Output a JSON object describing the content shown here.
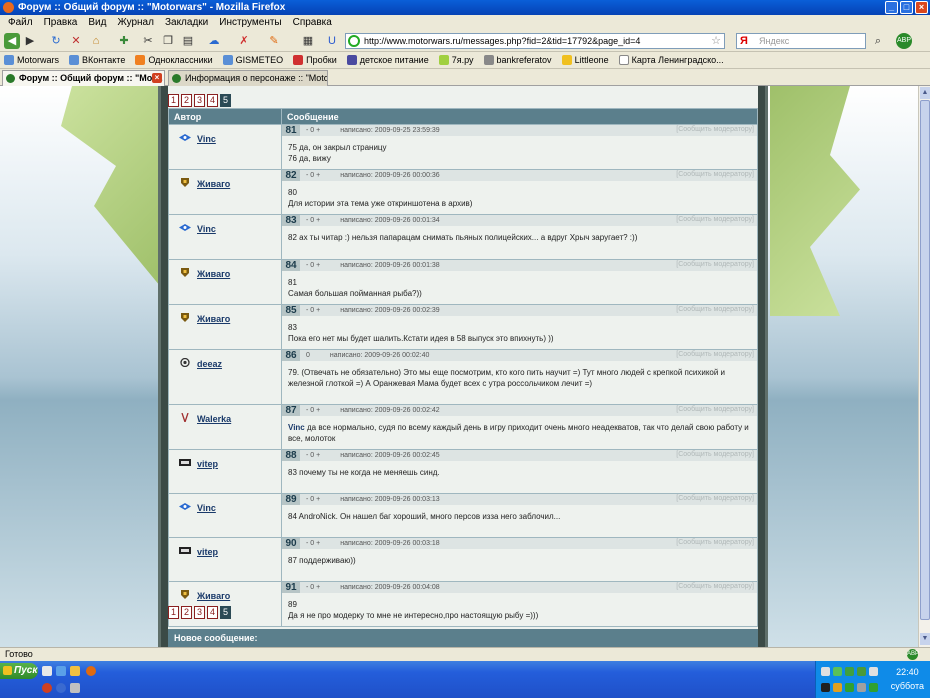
{
  "window": {
    "title": "Форум :: Общий форум :: \"Motorwars\" - Mozilla Firefox"
  },
  "menu": [
    "Файл",
    "Правка",
    "Вид",
    "Журнал",
    "Закладки",
    "Инструменты",
    "Справка"
  ],
  "nav": {
    "url": "http://www.motorwars.ru/messages.php?fid=2&tid=17792&page_id=4",
    "search_placeholder": "Яндекс",
    "search_engine": "Я"
  },
  "bookmarks": [
    "Motorwars",
    "ВКонтакте",
    "Одноклассники",
    "GISMETEO",
    "Пробки",
    "детское питание",
    "7я.ру",
    "bankreferatov",
    "Littleone",
    "Карта Ленинградско..."
  ],
  "tabs": [
    {
      "label": "Форум :: Общий форум :: \"Mot...",
      "active": true
    },
    {
      "label": "Информация о персонаже :: \"Motorw...",
      "active": false
    }
  ],
  "pager": {
    "pages": [
      "1",
      "2",
      "3",
      "4",
      "5"
    ],
    "current": "5"
  },
  "table": {
    "author_header": "Автор",
    "message_header": "Сообщение"
  },
  "vote_text": "- 0 +",
  "vote_text_zero": "0",
  "report_text": "[Сообщить модератору]",
  "posts": [
    {
      "num": "81",
      "author": "Vinc",
      "icon": "vinc",
      "date": "написано: 2009-09-25 23:59:39",
      "text": "75 да, он закрыл страницу\n76 да, вижу"
    },
    {
      "num": "82",
      "author": "Живаго",
      "icon": "shield",
      "date": "написано: 2009-09-26 00:00:36",
      "text": "80\nДля истории эта тема уже откриншотена в архив)"
    },
    {
      "num": "83",
      "author": "Vinc",
      "icon": "vinc",
      "date": "написано: 2009-09-26 00:01:34",
      "text": "82 ах ты читар :) нельзя папарацам снимать пьяных полицейских... а вдруг Хрыч заругает? :))"
    },
    {
      "num": "84",
      "author": "Живаго",
      "icon": "shield",
      "date": "написано: 2009-09-26 00:01:38",
      "text": "81\nСамая большая пойманная рыба?))"
    },
    {
      "num": "85",
      "author": "Живаго",
      "icon": "shield",
      "date": "написано: 2009-09-26 00:02:39",
      "text": "83\nПока его нет мы будет шалить.Кстати идея в 58 выпуск это впихнуть) ))"
    },
    {
      "num": "86",
      "author": "deeaz",
      "icon": "deeaz",
      "date": "написано: 2009-09-26 00:02:40",
      "text": "79. (Отвечать не обязательно) Это мы еще посмотрим, кто кого пить научит =) Тут много людей с крепкой психикой и железной глоткой =) А Оранжевая Мама будет всех с утра россольчиком лечит =)",
      "vote_zero": true
    },
    {
      "num": "87",
      "author": "Walerka",
      "icon": "walerka",
      "date": "написано: 2009-09-26 00:02:42",
      "text_bold": "Vinc",
      "text": " да все нормально, судя по всему каждый день в игру приходит очень много неадекватов, так что делай свою работу и все, молоток"
    },
    {
      "num": "88",
      "author": "vitep",
      "icon": "iqs",
      "date": "написано: 2009-09-26 00:02:45",
      "text": "83 почему ты не когда не меняешь синд."
    },
    {
      "num": "89",
      "author": "Vinc",
      "icon": "vinc",
      "date": "написано: 2009-09-26 00:03:13",
      "text": "84 AndroNick. Он нашел баг хороший, много персов изза него заблочил..."
    },
    {
      "num": "90",
      "author": "vitep",
      "icon": "iqs",
      "date": "написано: 2009-09-26 00:03:18",
      "text": "87 поддерживаю))"
    },
    {
      "num": "91",
      "author": "Живаго",
      "icon": "shield",
      "date": "написано: 2009-09-26 00:04:08",
      "text": "89\nДа я не про модерку то мне не интересно,про настоящую рыбу =)))"
    }
  ],
  "new_message": "Новое сообщение:",
  "status": "Готово",
  "taskbar": {
    "start": "Пуск",
    "time": "22:40",
    "day": "суббота"
  }
}
